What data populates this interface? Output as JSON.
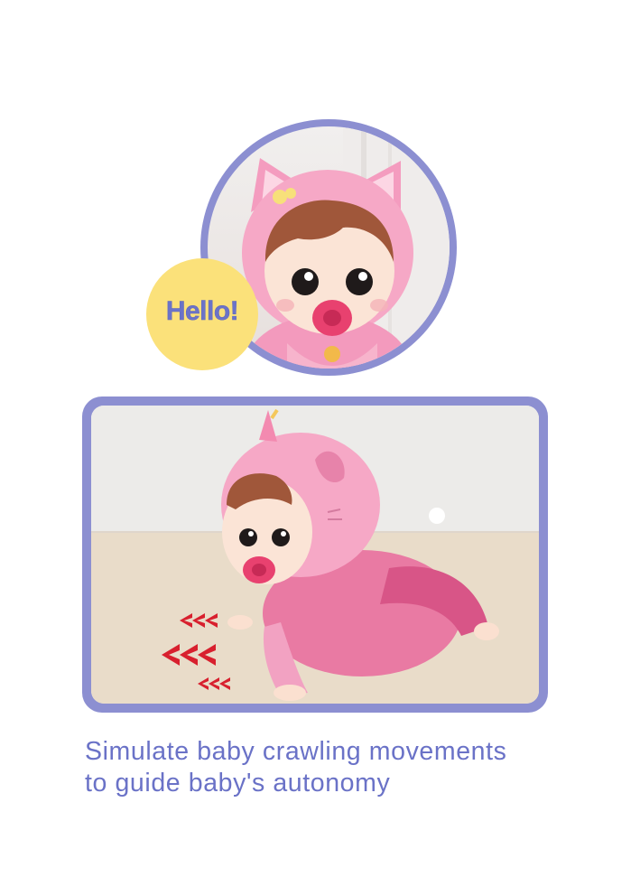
{
  "badge": {
    "text": "Hello!"
  },
  "caption": {
    "line1": "Simulate baby crawling movements",
    "line2": "to guide baby's autonomy"
  },
  "colors": {
    "frame": "#8c8fd1",
    "badge_fill": "#fbe17a",
    "text": "#6a72c7",
    "doll_pink": "#f5a3c3",
    "pacifier": "#e8416f"
  }
}
